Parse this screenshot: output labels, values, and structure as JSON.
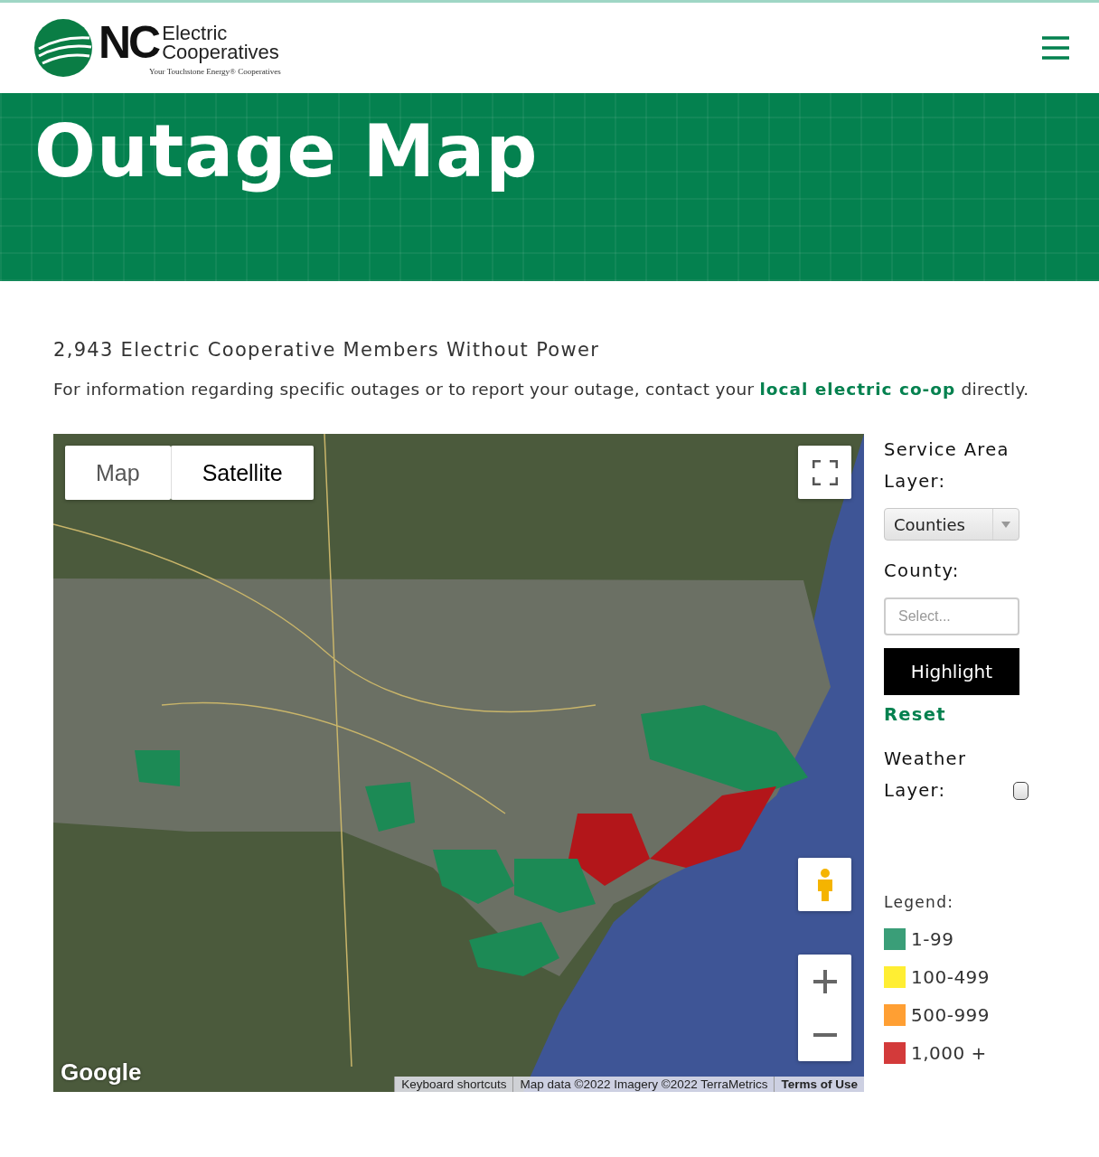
{
  "header": {
    "logo": {
      "initials": "NC",
      "line1": "Electric",
      "line2": "Cooperatives",
      "tagline": "Your Touchstone Energy® Cooperatives"
    }
  },
  "banner": {
    "title": "Outage Map"
  },
  "summary": {
    "heading": "2,943 Electric Cooperative Members Without Power",
    "text": "For information regarding specific outages or to report your outage, contact your",
    "link": "local electric co-op",
    "text_end": "directly."
  },
  "map": {
    "map_types": [
      {
        "label": "Map",
        "selected": false
      },
      {
        "label": "Satellite",
        "selected": true
      }
    ],
    "google": "Google",
    "attribution": [
      "Keyboard shortcuts",
      "Map data ©2022 Imagery ©2022 TerraMetrics",
      "Terms of Use"
    ]
  },
  "sidebar": {
    "service_area_label": "Service Area Layer:",
    "layer_select": "Counties",
    "county_label": "County:",
    "county_placeholder": "Select...",
    "highlight_button": "Highlight",
    "reset_link": "Reset",
    "weather_label": "Weather Layer:",
    "weather_checked": false,
    "legend": {
      "title": "Legend:",
      "items": [
        {
          "label": "1-99",
          "color": "#3a9e78"
        },
        {
          "label": "100-499",
          "color": "#ffee33"
        },
        {
          "label": "500-999",
          "color": "#ff9f33"
        },
        {
          "label": "1,000 +",
          "color": "#d33a3a"
        }
      ]
    }
  }
}
